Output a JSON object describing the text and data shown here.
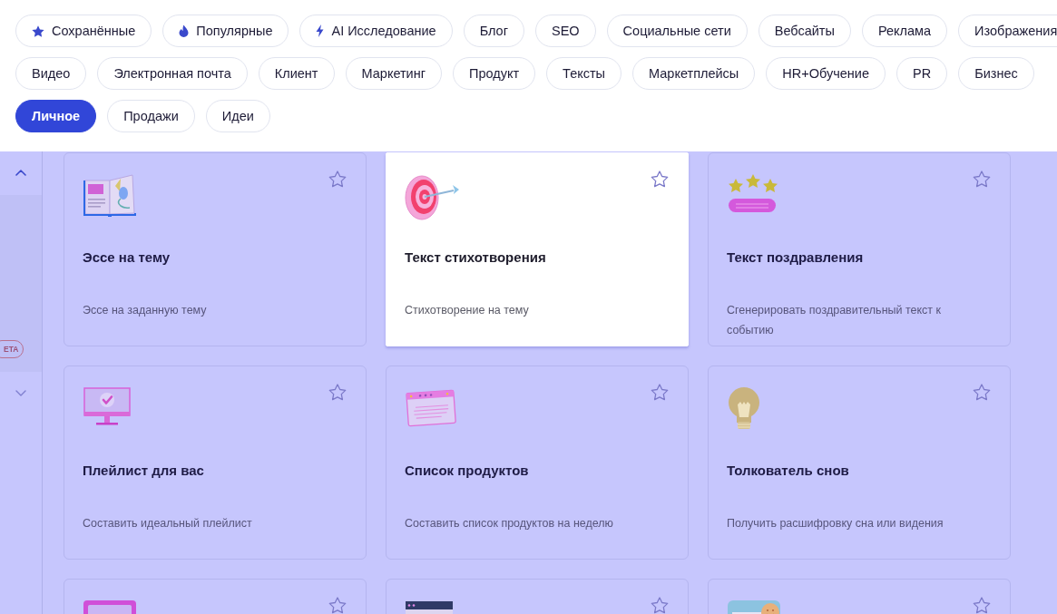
{
  "filter_chips": [
    {
      "label": "Сохранённые",
      "kind": "saved",
      "selected": false
    },
    {
      "label": "Популярные",
      "kind": "popular",
      "selected": false
    },
    {
      "label": "AI Исследование",
      "kind": "research",
      "selected": false
    },
    {
      "label": "Блог",
      "kind": "category",
      "selected": false
    },
    {
      "label": "SEO",
      "kind": "category",
      "selected": false
    },
    {
      "label": "Социальные сети",
      "kind": "category",
      "selected": false
    },
    {
      "label": "Вебсайты",
      "kind": "category",
      "selected": false
    },
    {
      "label": "Реклама",
      "kind": "category",
      "selected": false
    },
    {
      "label": "Изображения",
      "kind": "category",
      "selected": false
    },
    {
      "label": "Видео",
      "kind": "category",
      "selected": false
    },
    {
      "label": "Электронная почта",
      "kind": "category",
      "selected": false
    },
    {
      "label": "Клиент",
      "kind": "category",
      "selected": false
    },
    {
      "label": "Маркетинг",
      "kind": "category",
      "selected": false
    },
    {
      "label": "Продукт",
      "kind": "category",
      "selected": false
    },
    {
      "label": "Тексты",
      "kind": "category",
      "selected": false
    },
    {
      "label": "Маркетплейсы",
      "kind": "category",
      "selected": false
    },
    {
      "label": "HR+Обучение",
      "kind": "category",
      "selected": false
    },
    {
      "label": "PR",
      "kind": "category",
      "selected": false
    },
    {
      "label": "Бизнес",
      "kind": "category",
      "selected": false
    },
    {
      "label": "Личное",
      "kind": "category",
      "selected": true
    },
    {
      "label": "Продажи",
      "kind": "category",
      "selected": false
    },
    {
      "label": "Идеи",
      "kind": "category",
      "selected": false
    }
  ],
  "sidebar": {
    "badge": "ETA"
  },
  "cards": [
    {
      "title": "Эссе на тему",
      "description": "Эссе на заданную тему",
      "saved": false,
      "highlighted": false
    },
    {
      "title": "Текст стихотворения",
      "description": "Стихотворение на тему",
      "saved": false,
      "highlighted": true
    },
    {
      "title": "Текст поздравления",
      "description": "Сгенерировать поздравительный текст к событию",
      "saved": false,
      "highlighted": false
    },
    {
      "title": "Плейлист для вас",
      "description": "Составить идеальный плейлист",
      "saved": false,
      "highlighted": false
    },
    {
      "title": "Список продуктов",
      "description": "Составить список продуктов на неделю",
      "saved": false,
      "highlighted": false
    },
    {
      "title": "Толкователь снов",
      "description": "Получить расшифровку сна или видения",
      "saved": false,
      "highlighted": false
    },
    {
      "saved": false,
      "highlighted": false
    },
    {
      "saved": false,
      "highlighted": false
    },
    {
      "saved": false,
      "highlighted": false
    }
  ]
}
